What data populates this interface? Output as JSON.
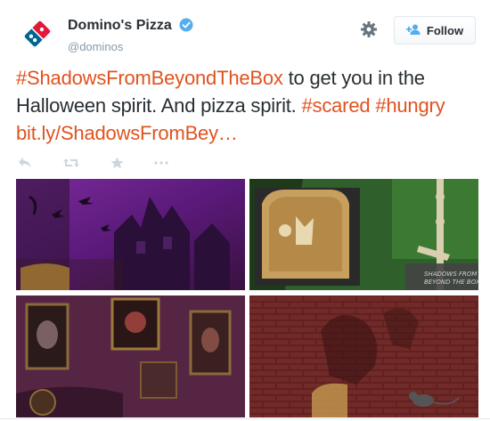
{
  "account": {
    "name": "Domino's Pizza",
    "handle": "@dominos",
    "verified": true,
    "avatar_icon": "dominos-logo-icon"
  },
  "header_actions": {
    "settings_icon": "gear-icon",
    "follow_label": "Follow",
    "follow_icon": "add-user-icon"
  },
  "tweet": {
    "hashtag1": "#ShadowsFromBeyondTheBox",
    "text1": " to get you in the Halloween spirit. And pizza spirit. ",
    "hashtag2": "#scared",
    "space": " ",
    "hashtag3": "#hungry",
    "link": "bit.ly/ShadowsFromBey…"
  },
  "tweet_actions": [
    "reply-icon",
    "retweet-icon",
    "favorite-star-icon",
    "more-dots-icon"
  ],
  "colors": {
    "link": "#e0531f",
    "text": "#292f33",
    "muted": "#8899a6",
    "verified": "#55acee",
    "brand_blue": "#006491",
    "brand_red": "#e31837"
  },
  "media": [
    {
      "name": "media-photo-purple-haunted-house"
    },
    {
      "name": "media-photo-tombstone-skeleton"
    },
    {
      "name": "media-photo-portraits-wall"
    },
    {
      "name": "media-photo-brick-wall-rat"
    }
  ]
}
